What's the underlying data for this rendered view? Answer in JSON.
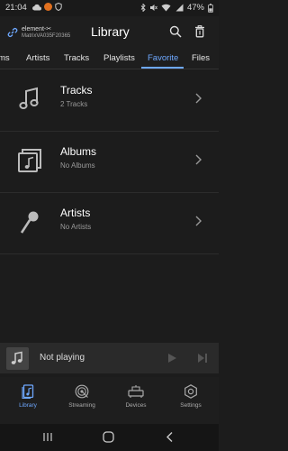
{
  "status_bar": {
    "time": "21:04",
    "battery": "47%"
  },
  "header": {
    "device_name": "element-✂",
    "device_sub": "MatrixVA035F20365",
    "title": "Library"
  },
  "tabs": [
    {
      "label": "ms"
    },
    {
      "label": "Artists"
    },
    {
      "label": "Tracks"
    },
    {
      "label": "Playlists"
    },
    {
      "label": "Favorite",
      "active": true
    },
    {
      "label": "Files"
    }
  ],
  "items": [
    {
      "title": "Tracks",
      "subtitle": "2 Tracks",
      "icon": "music-note-icon"
    },
    {
      "title": "Albums",
      "subtitle": "No Albums",
      "icon": "album-icon"
    },
    {
      "title": "Artists",
      "subtitle": "No Artists",
      "icon": "microphone-icon"
    }
  ],
  "player": {
    "status": "Not playing"
  },
  "bottom_nav": [
    {
      "label": "Library",
      "icon": "library-icon",
      "active": true
    },
    {
      "label": "Streaming",
      "icon": "streaming-icon"
    },
    {
      "label": "Devices",
      "icon": "devices-icon"
    },
    {
      "label": "Settings",
      "icon": "settings-icon"
    }
  ],
  "colors": {
    "accent": "#6ea8ff",
    "background": "#1c1c1c",
    "notification": "#e0701f"
  }
}
